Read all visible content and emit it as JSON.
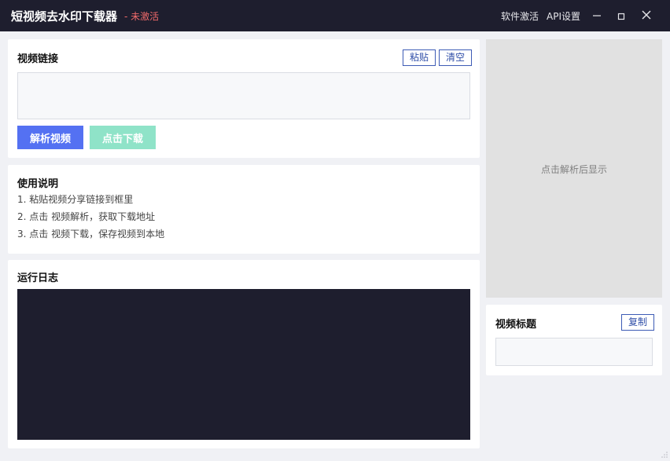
{
  "titlebar": {
    "title": "短视频去水印下载器",
    "status": "- 未激活",
    "menu_activate": "软件激活",
    "menu_api": "API设置"
  },
  "link_panel": {
    "title": "视频链接",
    "paste_label": "粘贴",
    "clear_label": "清空",
    "input_value": "",
    "parse_label": "解析视频",
    "download_label": "点击下载"
  },
  "help_panel": {
    "title": "使用说明",
    "lines": [
      "1. 粘贴视频分享链接到框里",
      "2. 点击 视频解析，获取下载地址",
      "3. 点击 视频下载，保存视频到本地"
    ]
  },
  "log_panel": {
    "title": "运行日志"
  },
  "preview": {
    "placeholder": "点击解析后显示"
  },
  "title_panel": {
    "title": "视频标题",
    "copy_label": "复制",
    "input_value": ""
  },
  "icons": {
    "minimize": "minimize-icon",
    "maximize": "maximize-icon",
    "close": "close-icon"
  },
  "colors": {
    "titlebar_bg": "#1e1e2e",
    "status_red": "#f06a6a",
    "primary_blue": "#5471f2",
    "download_green": "#8fe3c8",
    "outline_blue": "#3d5bb5"
  }
}
